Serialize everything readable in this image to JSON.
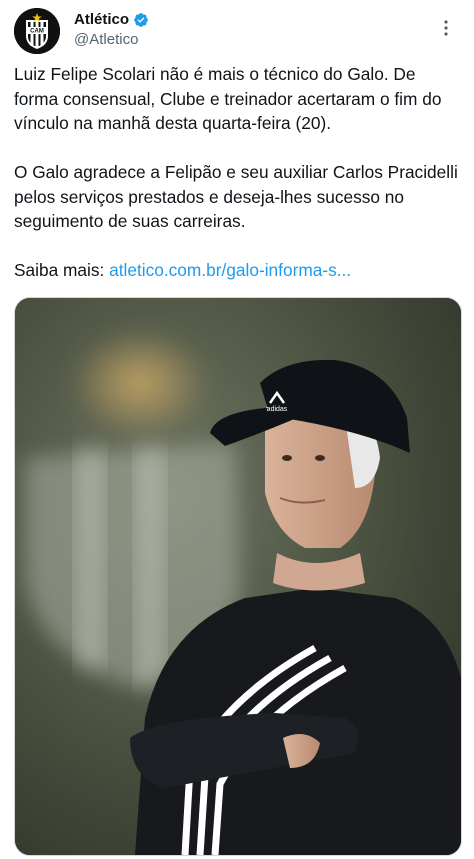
{
  "account": {
    "name": "Atlético",
    "handle": "@Atletico",
    "avatar_text": "CAM",
    "verified_icon": "verified-badge-icon",
    "more_icon": "more-vertical-icon"
  },
  "tweet": {
    "paragraph1": "Luiz Felipe Scolari não é mais o técnico do Galo. De forma consensual, Clube e treinador acertaram o fim do vínculo na manhã desta quarta-feira (20).",
    "paragraph2": "O Galo agradece a Felipão e seu auxiliar Carlos Pracidelli pelos serviços prestados e deseja-lhes sucesso no seguimento de suas carreiras.",
    "saiba_label": "Saiba mais:",
    "link_text": "atletico.com.br/galo-informa-s..."
  },
  "media": {
    "description_icon": "photo-coach-icon",
    "cap_logo_text": "adidas"
  },
  "colors": {
    "link": "#1d9bf0",
    "secondary_text": "#536471",
    "verified": "#1d9bf0"
  }
}
